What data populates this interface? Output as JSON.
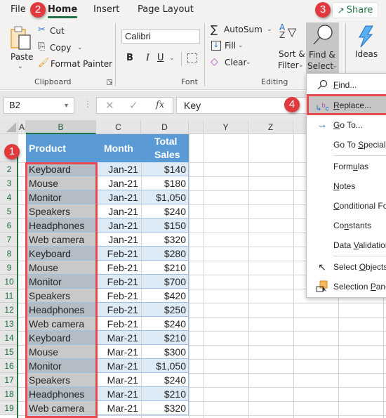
{
  "menu_tabs": {
    "file": "File",
    "home": "Home",
    "insert": "Insert",
    "page_layout": "Page Layout",
    "share": "Share"
  },
  "ribbon": {
    "clipboard": {
      "label": "Clipboard",
      "paste": "Paste",
      "cut": "Cut",
      "copy": "Copy",
      "format_painter": "Format Painter"
    },
    "font": {
      "label": "Font",
      "font_name": "Calibri",
      "bold": "B",
      "italic": "I",
      "underline": "U"
    },
    "editing": {
      "label": "Editing",
      "autosum": "AutoSum",
      "fill": "Fill",
      "clear": "Clear",
      "sort_filter_line1": "Sort &",
      "sort_filter_line2": "Filter",
      "find_select_line1": "Find &",
      "find_select_line2": "Select"
    },
    "ideas": "Ideas"
  },
  "formula_bar": {
    "name_box": "B2",
    "fx": "fx",
    "value": "Key"
  },
  "grid": {
    "columns": [
      "A",
      "B",
      "C",
      "D",
      "Y",
      "Z"
    ],
    "selected_column": "B",
    "headers": {
      "product": "Product",
      "month": "Month",
      "total_sales_line1": "Total",
      "total_sales_line2": "Sales"
    },
    "rows": [
      {
        "row": "2",
        "product": "Keyboard",
        "month": "Jan-21",
        "sales": "$140"
      },
      {
        "row": "3",
        "product": "Mouse",
        "month": "Jan-21",
        "sales": "$180"
      },
      {
        "row": "4",
        "product": "Monitor",
        "month": "Jan-21",
        "sales": "$1,050"
      },
      {
        "row": "5",
        "product": "Speakers",
        "month": "Jan-21",
        "sales": "$240"
      },
      {
        "row": "6",
        "product": "Headphones",
        "month": "Jan-21",
        "sales": "$150"
      },
      {
        "row": "7",
        "product": "Web camera",
        "month": "Jan-21",
        "sales": "$320"
      },
      {
        "row": "8",
        "product": "Keyboard",
        "month": "Feb-21",
        "sales": "$280"
      },
      {
        "row": "9",
        "product": "Mouse",
        "month": "Feb-21",
        "sales": "$210"
      },
      {
        "row": "10",
        "product": "Monitor",
        "month": "Feb-21",
        "sales": "$700"
      },
      {
        "row": "11",
        "product": "Speakers",
        "month": "Feb-21",
        "sales": "$420"
      },
      {
        "row": "12",
        "product": "Headphones",
        "month": "Feb-21",
        "sales": "$250"
      },
      {
        "row": "13",
        "product": "Web camera",
        "month": "Feb-21",
        "sales": "$240"
      },
      {
        "row": "14",
        "product": "Keyboard",
        "month": "Mar-21",
        "sales": "$210"
      },
      {
        "row": "15",
        "product": "Mouse",
        "month": "Mar-21",
        "sales": "$300"
      },
      {
        "row": "16",
        "product": "Monitor",
        "month": "Mar-21",
        "sales": "$1,050"
      },
      {
        "row": "17",
        "product": "Speakers",
        "month": "Mar-21",
        "sales": "$240"
      },
      {
        "row": "18",
        "product": "Headphones",
        "month": "Mar-21",
        "sales": "$210"
      },
      {
        "row": "19",
        "product": "Web camera",
        "month": "Mar-21",
        "sales": "$320"
      }
    ]
  },
  "find_select_menu": {
    "items": [
      {
        "label": "Find...",
        "icon": "search-icon"
      },
      {
        "label": "Replace...",
        "icon": "replace-icon",
        "highlighted": true
      },
      {
        "label": "Go To...",
        "icon": "arrow-right-icon"
      },
      {
        "label": "Go To Special...",
        "icon": ""
      },
      {
        "label": "Formulas",
        "icon": ""
      },
      {
        "label": "Notes",
        "icon": ""
      },
      {
        "label": "Conditional Formatting",
        "icon": ""
      },
      {
        "label": "Constants",
        "icon": ""
      },
      {
        "label": "Data Validation",
        "icon": ""
      },
      {
        "label": "Select Objects",
        "icon": "cursor-icon"
      },
      {
        "label": "Selection Pane...",
        "icon": "selection-pane-icon"
      }
    ]
  },
  "annotations": {
    "step1": "1",
    "step2": "2",
    "step3": "3",
    "step4": "4"
  },
  "colors": {
    "accent_green": "#217346",
    "table_header_blue": "#5b9bd5",
    "row_band_light": "#ddebf7",
    "selection_gray": "#c9c9c9",
    "annotation_red": "#e0393e"
  }
}
